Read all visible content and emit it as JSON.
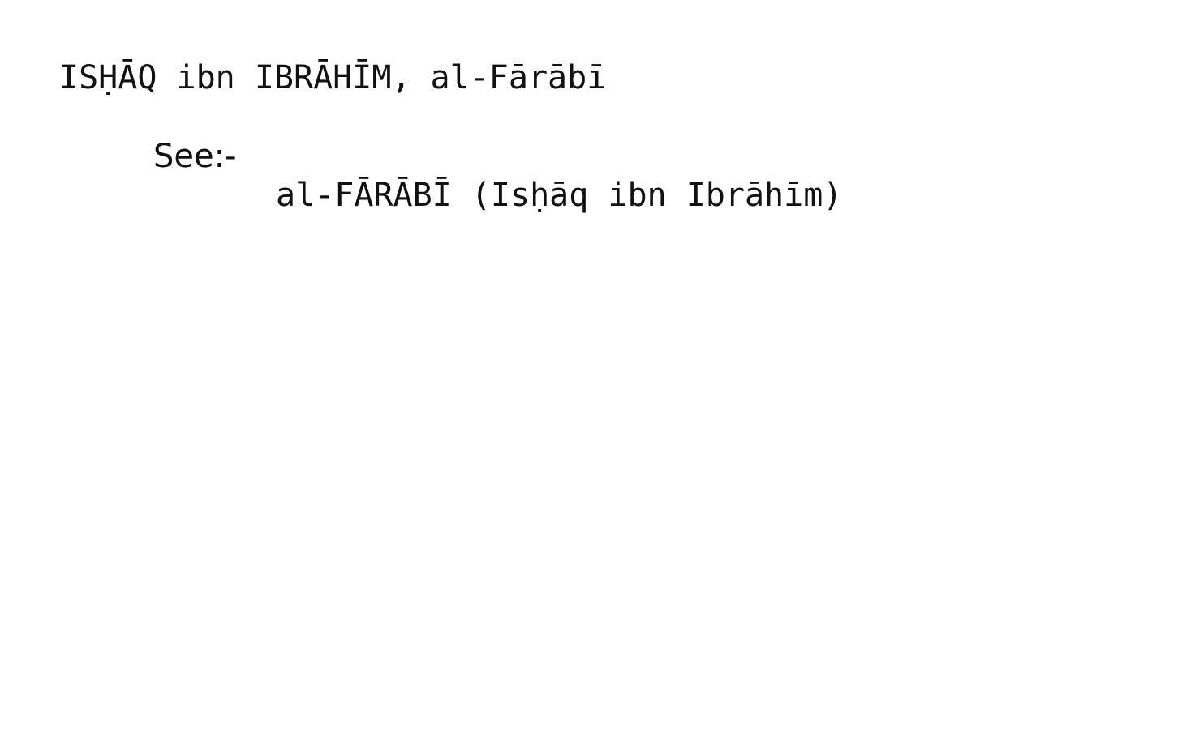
{
  "card": {
    "heading": "ISḤĀQ ibn IBRĀHĪM, al-Fārābī",
    "see_label": "See:-",
    "reference": "al-FĀRĀBĪ (Isḥāq ibn Ibrāhīm)"
  }
}
